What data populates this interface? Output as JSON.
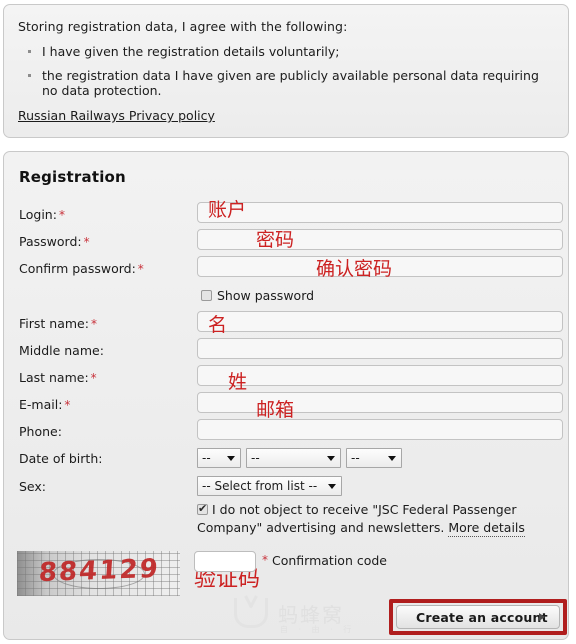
{
  "consent": {
    "intro": "Storing registration data, I agree with the following:",
    "items": [
      "I have given the registration details voluntarily;",
      "the registration data I have given are publicly available personal data requiring no data protection."
    ],
    "privacy_link": "Russian Railways Privacy policy"
  },
  "registration": {
    "title": "Registration",
    "fields": [
      {
        "label": "Login:",
        "required": true,
        "annotation": "账户"
      },
      {
        "label": "Password:",
        "required": true,
        "annotation": "密码"
      },
      {
        "label": "Confirm password:",
        "required": true,
        "annotation": "确认密码"
      },
      {
        "label": "First name:",
        "required": true,
        "annotation": "名"
      },
      {
        "label": "Middle name:",
        "required": false,
        "annotation": ""
      },
      {
        "label": "Last name:",
        "required": true,
        "annotation": "姓"
      },
      {
        "label": "E-mail:",
        "required": true,
        "annotation": "邮箱"
      },
      {
        "label": "Phone:",
        "required": false,
        "annotation": ""
      }
    ],
    "show_password": {
      "label": "Show password",
      "checked": false
    },
    "date_of_birth": {
      "label": "Date of birth:",
      "day": "--",
      "month": "--",
      "year": "--"
    },
    "sex": {
      "label": "Sex:",
      "value": "-- Select from list --"
    },
    "newsletter": {
      "checked": true,
      "text": "I do not object to receive \"JSC Federal Passenger Company\" advertising and newsletters.",
      "more_details": "More details"
    },
    "captcha": {
      "code_text": "884129",
      "input_value": "",
      "required_mark": "*",
      "label": "Confirmation code",
      "annotation": "验证码"
    },
    "submit": {
      "label": "Create an account",
      "arrow_icon": "triangle-right-icon"
    }
  },
  "watermark": {
    "name": "蚂蜂窝",
    "sub": "自 · 由 · 行",
    "logo_icon": "mafengwo-logo-icon"
  },
  "colors": {
    "accent_red": "#cc2222",
    "highlight_red": "#b01e1e",
    "required_red": "#c8313a",
    "panel_bg": "#eeeeee",
    "panel_border": "#c9c9c9"
  }
}
